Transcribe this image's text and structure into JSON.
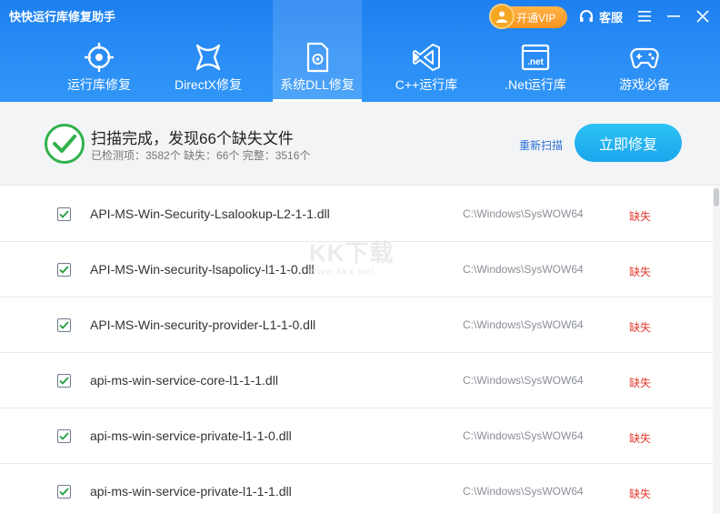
{
  "app": {
    "title": "快快运行库修复助手"
  },
  "header": {
    "vip_label": "开通VIP",
    "service_label": "客服"
  },
  "tabs": [
    {
      "label": "运行库修复",
      "icon": "target-icon"
    },
    {
      "label": "DirectX修复",
      "icon": "directx-icon"
    },
    {
      "label": "系统DLL修复",
      "icon": "dll-file-icon",
      "active": true
    },
    {
      "label": "C++运行库",
      "icon": "visual-studio-icon"
    },
    {
      "label": ".Net运行库",
      "icon": "dotnet-icon"
    },
    {
      "label": "游戏必备",
      "icon": "gamepad-icon"
    }
  ],
  "status": {
    "title": "扫描完成，发现66个缺失文件",
    "summary": "已检测项：3582个  缺失：66个  完整：3516个",
    "rescan_label": "重新扫描",
    "fix_label": "立即修复"
  },
  "rows": [
    {
      "name": "API-MS-Win-Security-Lsalookup-L2-1-1.dll",
      "path": "C:\\Windows\\SysWOW64",
      "status": "缺失",
      "checked": true
    },
    {
      "name": "API-MS-Win-security-lsapolicy-l1-1-0.dll",
      "path": "C:\\Windows\\SysWOW64",
      "status": "缺失",
      "checked": true
    },
    {
      "name": "API-MS-Win-security-provider-L1-1-0.dll",
      "path": "C:\\Windows\\SysWOW64",
      "status": "缺失",
      "checked": true
    },
    {
      "name": "api-ms-win-service-core-l1-1-1.dll",
      "path": "C:\\Windows\\SysWOW64",
      "status": "缺失",
      "checked": true
    },
    {
      "name": "api-ms-win-service-private-l1-1-0.dll",
      "path": "C:\\Windows\\SysWOW64",
      "status": "缺失",
      "checked": true
    },
    {
      "name": "api-ms-win-service-private-l1-1-1.dll",
      "path": "C:\\Windows\\SysWOW64",
      "status": "缺失",
      "checked": true
    }
  ],
  "watermark": {
    "main": "KK下载",
    "sub": "www.kkx.net"
  },
  "colors": {
    "header": "#2a8df5",
    "accent": "#1ba6ec",
    "missing": "#e23a2e",
    "success": "#2fb24a"
  }
}
